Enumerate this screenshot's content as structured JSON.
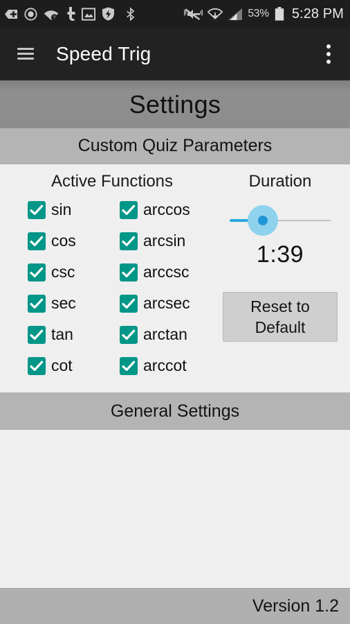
{
  "statusbar": {
    "left_icons": [
      "add-tag-icon",
      "target-circle-icon",
      "wifi-unknown-icon",
      "tango-phone-icon",
      "screenshot-image-icon",
      "shield-flash-icon",
      "bluetooth-icon"
    ],
    "right_icons": [
      "volume-mute-vibrate-icon",
      "wifi-download-icon",
      "cellular-signal-icon"
    ],
    "battery_percent": "53%",
    "battery_icon": "battery-icon",
    "clock": "5:28 PM"
  },
  "appbar": {
    "menu_icon": "hamburger-menu-icon",
    "title": "Speed Trig",
    "overflow_icon": "overflow-menu-icon"
  },
  "page": {
    "title": "Settings"
  },
  "sections": {
    "custom_quiz": {
      "header": "Custom Quiz Parameters",
      "functions_heading": "Active Functions",
      "functions": [
        {
          "label": "sin",
          "checked": true
        },
        {
          "label": "arccos",
          "checked": true
        },
        {
          "label": "cos",
          "checked": true
        },
        {
          "label": "arcsin",
          "checked": true
        },
        {
          "label": "csc",
          "checked": true
        },
        {
          "label": "arccsc",
          "checked": true
        },
        {
          "label": "sec",
          "checked": true
        },
        {
          "label": "arcsec",
          "checked": true
        },
        {
          "label": "tan",
          "checked": true
        },
        {
          "label": "arctan",
          "checked": true
        },
        {
          "label": "cot",
          "checked": true
        },
        {
          "label": "arccot",
          "checked": true
        }
      ],
      "duration": {
        "heading": "Duration",
        "value": "1:39",
        "slider_percent": 33
      },
      "reset_button": "Reset to\nDefault"
    },
    "general": {
      "header": "General Settings"
    }
  },
  "footer": {
    "version": "Version 1.2"
  },
  "colors": {
    "accent_teal": "#009688",
    "slider_blue": "#2196d4",
    "slider_halo": "#8ed2ee",
    "statusbar_bg": "#1d1d1d",
    "appbar_bg": "#222222",
    "band_dark": "#8d8d8d",
    "band_light": "#b4b4b4",
    "content_bg": "#efefef"
  }
}
